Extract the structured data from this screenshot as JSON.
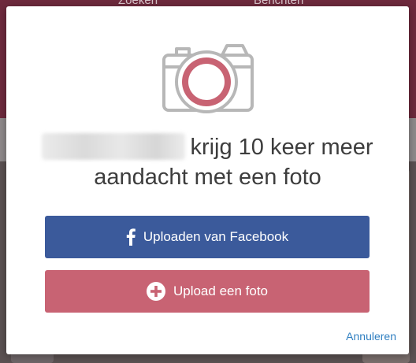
{
  "background": {
    "nav_items": [
      "Zoeken",
      "Berichten"
    ]
  },
  "modal": {
    "headline_line1": "krijg 10 keer meer",
    "headline_line2": "aandacht met een foto",
    "facebook_button_label": "Uploaden van Facebook",
    "upload_button_label": "Upload een foto",
    "cancel_label": "Annuleren"
  },
  "icons": {
    "camera": "camera-icon",
    "facebook": "facebook-icon",
    "plus": "plus-circle-icon"
  },
  "colors": {
    "facebook_blue": "#3b5a9b",
    "brand_rose": "#c86373",
    "link_blue": "#2f7fc1",
    "camera_gray": "#b7b7b7"
  }
}
